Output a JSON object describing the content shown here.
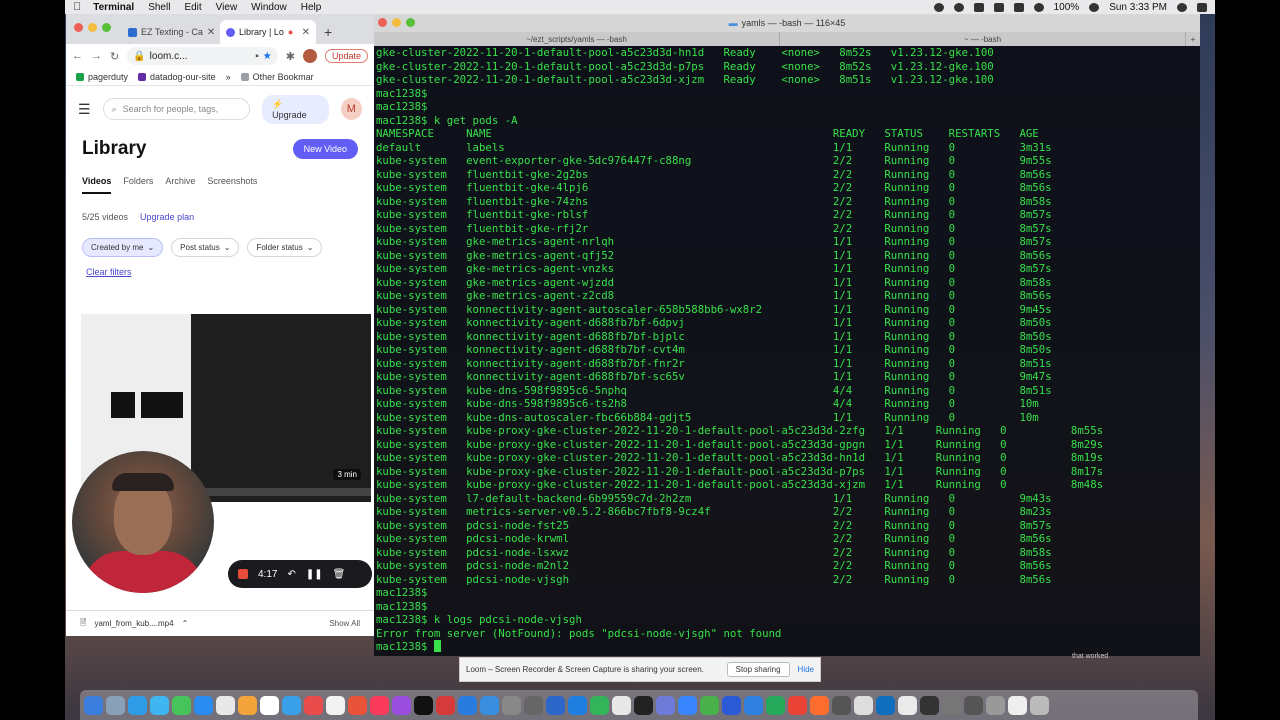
{
  "menubar": {
    "app_name": "Terminal",
    "items": [
      "Shell",
      "Edit",
      "View",
      "Window",
      "Help"
    ],
    "battery": "100%",
    "clock": "Sun 3:33 PM"
  },
  "browser": {
    "tabs": [
      {
        "label": "EZ Texting - Ca",
        "active": false
      },
      {
        "label": "Library | Lo",
        "active": true
      }
    ],
    "url": "loom.c...",
    "update_label": "Update",
    "bookmarks": [
      "pagerduty",
      "datadog-our-site"
    ],
    "other_bookmarks": "Other Bookmar",
    "loom": {
      "search_placeholder": "Search for people, tags,",
      "upgrade_label": "Upgrade",
      "avatar_initial": "M",
      "title": "Library",
      "new_video_label": "New Video",
      "tabs": [
        "Videos",
        "Folders",
        "Archive",
        "Screenshots"
      ],
      "video_count": "5/25 videos",
      "upgrade_plan": "Upgrade plan",
      "filters": [
        "Created by me",
        "Post status",
        "Folder status"
      ],
      "clear_filters": "Clear filters",
      "thumb_duration": "3 min"
    },
    "download": {
      "file": "yaml_from_kub....mp4",
      "show_all": "Show All"
    }
  },
  "terminal": {
    "title": "yamls — -bash — 116×45",
    "path": "~/ezt_scripts/yamls — -bash",
    "tab2": "~ — -bash",
    "lines": [
      "gke-cluster-2022-11-20-1-default-pool-a5c23d3d-hn1d   Ready    <none>   8m52s   v1.23.12-gke.100",
      "gke-cluster-2022-11-20-1-default-pool-a5c23d3d-p7ps   Ready    <none>   8m52s   v1.23.12-gke.100",
      "gke-cluster-2022-11-20-1-default-pool-a5c23d3d-xjzm   Ready    <none>   8m51s   v1.23.12-gke.100",
      "mac1238$",
      "mac1238$",
      "mac1238$ k get pods -A",
      "NAMESPACE     NAME                                                     READY   STATUS    RESTARTS   AGE",
      "default       labels                                                   1/1     Running   0          3m31s",
      "kube-system   event-exporter-gke-5dc976447f-c88ng                      2/2     Running   0          9m55s",
      "kube-system   fluentbit-gke-2g2bs                                      2/2     Running   0          8m56s",
      "kube-system   fluentbit-gke-4lpj6                                      2/2     Running   0          8m56s",
      "kube-system   fluentbit-gke-74zhs                                      2/2     Running   0          8m58s",
      "kube-system   fluentbit-gke-rblsf                                      2/2     Running   0          8m57s",
      "kube-system   fluentbit-gke-rfj2r                                      2/2     Running   0          8m57s",
      "kube-system   gke-metrics-agent-nrlqh                                  1/1     Running   0          8m57s",
      "kube-system   gke-metrics-agent-qfj52                                  1/1     Running   0          8m56s",
      "kube-system   gke-metrics-agent-vnzks                                  1/1     Running   0          8m57s",
      "kube-system   gke-metrics-agent-wjzdd                                  1/1     Running   0          8m58s",
      "kube-system   gke-metrics-agent-z2cd8                                  1/1     Running   0          8m56s",
      "kube-system   konnectivity-agent-autoscaler-658b588bb6-wx8r2           1/1     Running   0          9m45s",
      "kube-system   konnectivity-agent-d688fb7bf-6dpvj                       1/1     Running   0          8m50s",
      "kube-system   konnectivity-agent-d688fb7bf-bjplc                       1/1     Running   0          8m50s",
      "kube-system   konnectivity-agent-d688fb7bf-cvt4m                       1/1     Running   0          8m50s",
      "kube-system   konnectivity-agent-d688fb7bf-fnr2r                       1/1     Running   0          8m51s",
      "kube-system   konnectivity-agent-d688fb7bf-sc65v                       1/1     Running   0          9m47s",
      "kube-system   kube-dns-598f9895c6-5nphq                                4/4     Running   0          8m51s",
      "kube-system   kube-dns-598f9895c6-ts2h8                                4/4     Running   0          10m",
      "kube-system   kube-dns-autoscaler-fbc66b884-gdjt5                      1/1     Running   0          10m",
      "kube-system   kube-proxy-gke-cluster-2022-11-20-1-default-pool-a5c23d3d-2zfg   1/1     Running   0          8m55s",
      "kube-system   kube-proxy-gke-cluster-2022-11-20-1-default-pool-a5c23d3d-gpgn   1/1     Running   0          8m29s",
      "kube-system   kube-proxy-gke-cluster-2022-11-20-1-default-pool-a5c23d3d-hn1d   1/1     Running   0          8m19s",
      "kube-system   kube-proxy-gke-cluster-2022-11-20-1-default-pool-a5c23d3d-p7ps   1/1     Running   0          8m17s",
      "kube-system   kube-proxy-gke-cluster-2022-11-20-1-default-pool-a5c23d3d-xjzm   1/1     Running   0          8m48s",
      "kube-system   l7-default-backend-6b99559c7d-2h2zm                      1/1     Running   0          9m43s",
      "kube-system   metrics-server-v0.5.2-866bc7fbf8-9cz4f                   2/2     Running   0          8m23s",
      "kube-system   pdcsi-node-fst25                                         2/2     Running   0          8m57s",
      "kube-system   pdcsi-node-krwml                                         2/2     Running   0          8m56s",
      "kube-system   pdcsi-node-lsxwz                                         2/2     Running   0          8m58s",
      "kube-system   pdcsi-node-m2nl2                                         2/2     Running   0          8m56s",
      "kube-system   pdcsi-node-vjsgh                                         2/2     Running   0          8m56s",
      "mac1238$",
      "mac1238$",
      "mac1238$ k logs pdcsi-node-vjsgh",
      "Error from server (NotFound): pods \"pdcsi-node-vjsgh\" not found"
    ],
    "prompt": "mac1238$ "
  },
  "recording": {
    "time": "4:17"
  },
  "share_bar": {
    "message": "Loom – Screen Recorder & Screen Capture is sharing your screen.",
    "stop_label": "Stop sharing",
    "hide_label": "Hide"
  },
  "desktop_text": "that worked",
  "colors": {
    "terminal_text": "#38e04a",
    "loom_accent": "#625df5",
    "record": "#e74c3c"
  }
}
